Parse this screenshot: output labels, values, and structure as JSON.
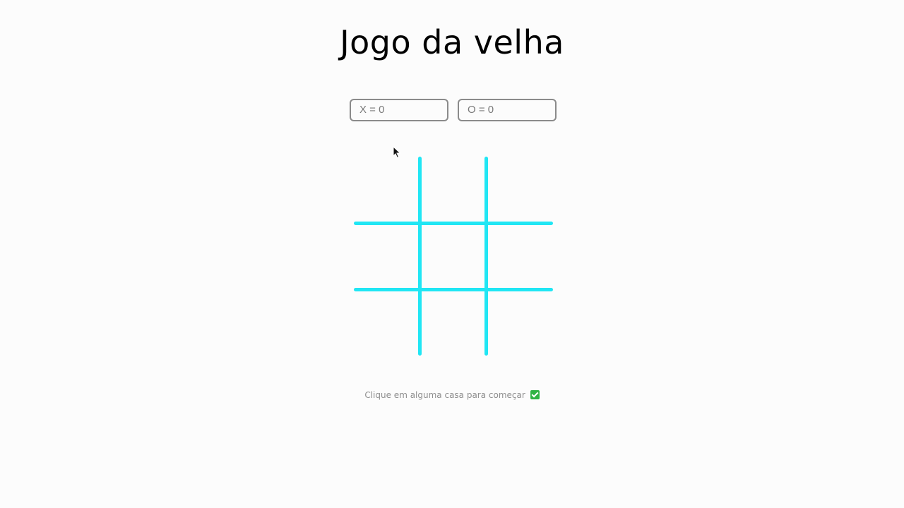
{
  "game": {
    "title": "Jogo da velha",
    "board_color": "#20e6f4",
    "cells": [
      "",
      "",
      "",
      "",
      "",
      "",
      "",
      "",
      ""
    ]
  },
  "scoreboard": {
    "x_placeholder": "X = 0",
    "o_placeholder": "O = 0"
  },
  "status": {
    "message": "Clique em alguma casa para começar",
    "icon": "check-mark-icon"
  }
}
